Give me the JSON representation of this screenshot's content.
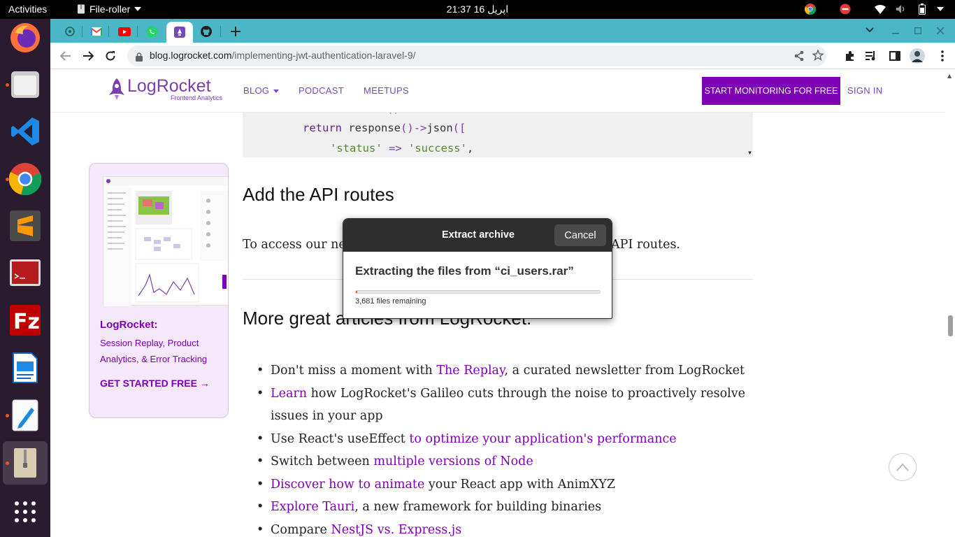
{
  "topbar": {
    "activities": "Activities",
    "app_name": "File-roller",
    "clock": "21:37  16 اپریل"
  },
  "dock": {
    "items": [
      "firefox",
      "files",
      "vscode",
      "chrome",
      "sublime-text",
      "terminal",
      "filezilla",
      "document-viewer",
      "text-editor",
      "archive-manager",
      "show-applications"
    ]
  },
  "browser": {
    "url_host": "blog.logrocket.com",
    "url_path": "/implementing-jwt-authentication-laravel-9/",
    "tabs": [
      "chatgpt",
      "gmail",
      "youtube",
      "whatsapp",
      "logrocket",
      "github"
    ]
  },
  "site": {
    "logo_main": "LogRocket",
    "logo_sub": "Frontend Analytics",
    "nav": {
      "blog": "BLOG",
      "podcast": "PODCAST",
      "meetups": "MEETUPS",
      "cta": "START MONITORING FOR FREE",
      "signin": "SIGN IN"
    }
  },
  "code": {
    "line1_ret": "return",
    "line1_fn": " response",
    "line1_rest": "()->",
    "line1_json": "json",
    "line1_end": "([",
    "line2_key": "'status'",
    "line2_arrow": " => ",
    "line2_val": "'success'",
    "line2_end": ","
  },
  "ad": {
    "title": "LogRocket:",
    "desc": "Session Replay, Product Analytics, & Error Tracking",
    "cta": "GET STARTED FREE →"
  },
  "article": {
    "heading_routes": "Add the API routes",
    "para_start": "To access our ne",
    "para_end": "API routes.",
    "heading_more": "More great articles from LogRocket:",
    "items": [
      {
        "pre": "Don't miss a moment with ",
        "link": "The Replay",
        "post": ", a curated newsletter from LogRocket"
      },
      {
        "pre": "",
        "link": "Learn",
        "post": " how LogRocket's Galileo cuts through the noise to proactively resolve issues in your app"
      },
      {
        "pre": "Use React's useEffect ",
        "link": "to optimize your application's performance",
        "post": ""
      },
      {
        "pre": "Switch between ",
        "link": "multiple versions of Node",
        "post": ""
      },
      {
        "pre": "",
        "link": "Discover how to animate",
        "post": " your React app with AnimXYZ"
      },
      {
        "pre": "",
        "link": "Explore Tauri",
        "post": ", a new framework for building binaries"
      },
      {
        "pre": "Compare ",
        "link": "NestJS vs. Express.js",
        "post": ""
      }
    ]
  },
  "dialog": {
    "title": "Extract archive",
    "cancel": "Cancel",
    "message": "Extracting the files from “ci_users.rar”",
    "remaining": "3,681 files remaining",
    "progress": 0.005
  },
  "colors": {
    "accent": "#7e00b5",
    "tabstrip": "#4ab6c6",
    "progress": "#e95420"
  }
}
